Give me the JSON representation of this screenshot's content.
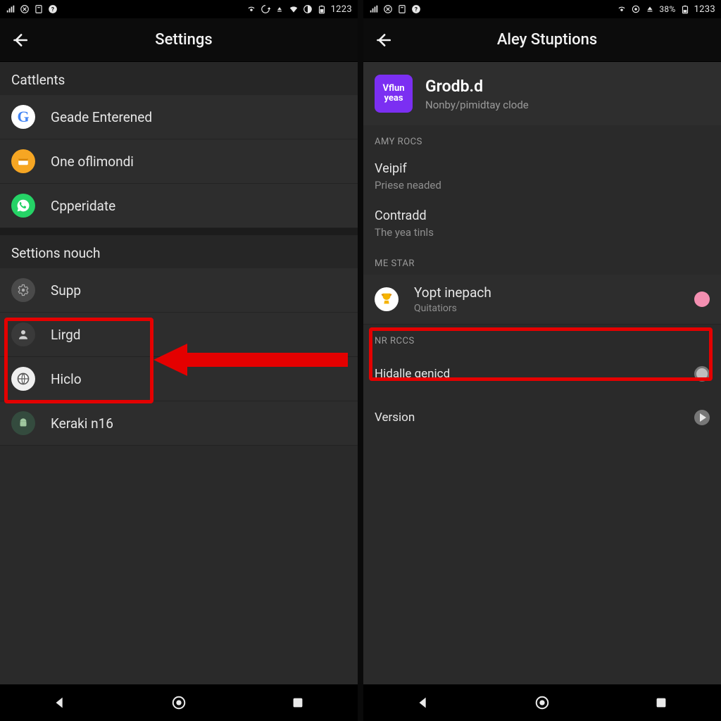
{
  "status": {
    "left_icons": [
      "signal",
      "nfc",
      "badge",
      "help"
    ],
    "right_icons": [
      "hotspot",
      "sync",
      "data",
      "wifi",
      "half",
      "battery"
    ],
    "time": "1223",
    "right2_icons": [
      "hotspot",
      "sync",
      "data",
      "pct",
      "battery"
    ],
    "pct": "38%",
    "time2": "1233"
  },
  "left": {
    "title": "Settings",
    "section1": "Cattlents",
    "items1": [
      {
        "label": "Geade Enterened",
        "icon": "google"
      },
      {
        "label": "One oflimondi",
        "icon": "wallet"
      },
      {
        "label": "Cpperidate",
        "icon": "whats"
      }
    ],
    "section2": "Settions nouch",
    "items2": [
      {
        "label": "Supp",
        "icon": "grey"
      },
      {
        "label": "Lirgd",
        "icon": "person"
      },
      {
        "label": "Hiclo",
        "icon": "ball"
      },
      {
        "label": "Keraki n16",
        "icon": "robot"
      }
    ]
  },
  "right": {
    "title": "Aley Stuptions",
    "app": {
      "badge_top": "Vflun",
      "badge_bot": "yeas",
      "name": "Grodb.d",
      "sub": "Nonby/pimidtay clode"
    },
    "sec1": "AMY ROCS",
    "g1": [
      {
        "t1": "Veipif",
        "t2": "Priese neaded"
      },
      {
        "t1": "Contradd",
        "t2": "The yea tinls"
      }
    ],
    "sec2": "ME STAR",
    "g2": {
      "t1": "Yopt inepach",
      "t2": "Quitatiors"
    },
    "sec3": "NR RCCS",
    "g3a": "Hidalle genicd",
    "g3b": "Version"
  }
}
